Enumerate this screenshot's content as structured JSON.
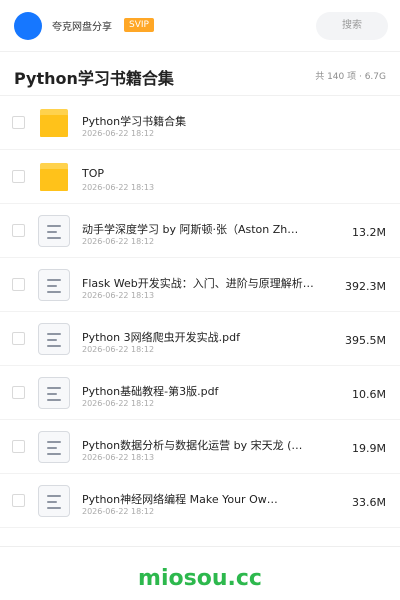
{
  "header": {
    "site_name": "夸克网盘分享",
    "badge": "SVIP",
    "search_label": "搜索"
  },
  "folder": {
    "title": "Python学习书籍合集",
    "meta": "共 140 项 · 6.7G"
  },
  "files": [
    {
      "type": "folder",
      "icon": "folder-icon",
      "name": "Python学习书籍合集",
      "date": "2026-06-22 18:12",
      "size": ""
    },
    {
      "type": "folder",
      "icon": "folder-icon",
      "name": "TOP",
      "date": "2026-06-22 18:13",
      "size": ""
    },
    {
      "type": "file",
      "icon": "document-icon",
      "name": "动手学深度学习 by 阿斯顿·张（Aston Zh…",
      "date": "2026-06-22 18:12",
      "size": "13.2M"
    },
    {
      "type": "file",
      "icon": "document-icon",
      "name": "Flask Web开发实战：入门、进阶与原理解析【…",
      "date": "2026-06-22 18:13",
      "size": "392.3M"
    },
    {
      "type": "file",
      "icon": "document-icon",
      "name": "Python 3网络爬虫开发实战.pdf",
      "date": "2026-06-22 18:12",
      "size": "395.5M"
    },
    {
      "type": "file",
      "icon": "document-icon",
      "name": "Python基础教程-第3版.pdf",
      "date": "2026-06-22 18:12",
      "size": "10.6M"
    },
    {
      "type": "file",
      "icon": "document-icon",
      "name": "Python数据分析与数据化运营 by 宋天龙 (…",
      "date": "2026-06-22 18:13",
      "size": "19.9M"
    },
    {
      "type": "file",
      "icon": "document-icon",
      "name": "Python神经网络编程 Make Your Ow…",
      "date": "2026-06-22 18:12",
      "size": "33.6M"
    }
  ],
  "footer": {
    "brand": "miosou.cc"
  },
  "colors": {
    "accent_blue": "#1677ff",
    "svip_orange": "#ffa726",
    "folder_yellow": "#ffc21a",
    "brand_green": "#2db84d"
  }
}
